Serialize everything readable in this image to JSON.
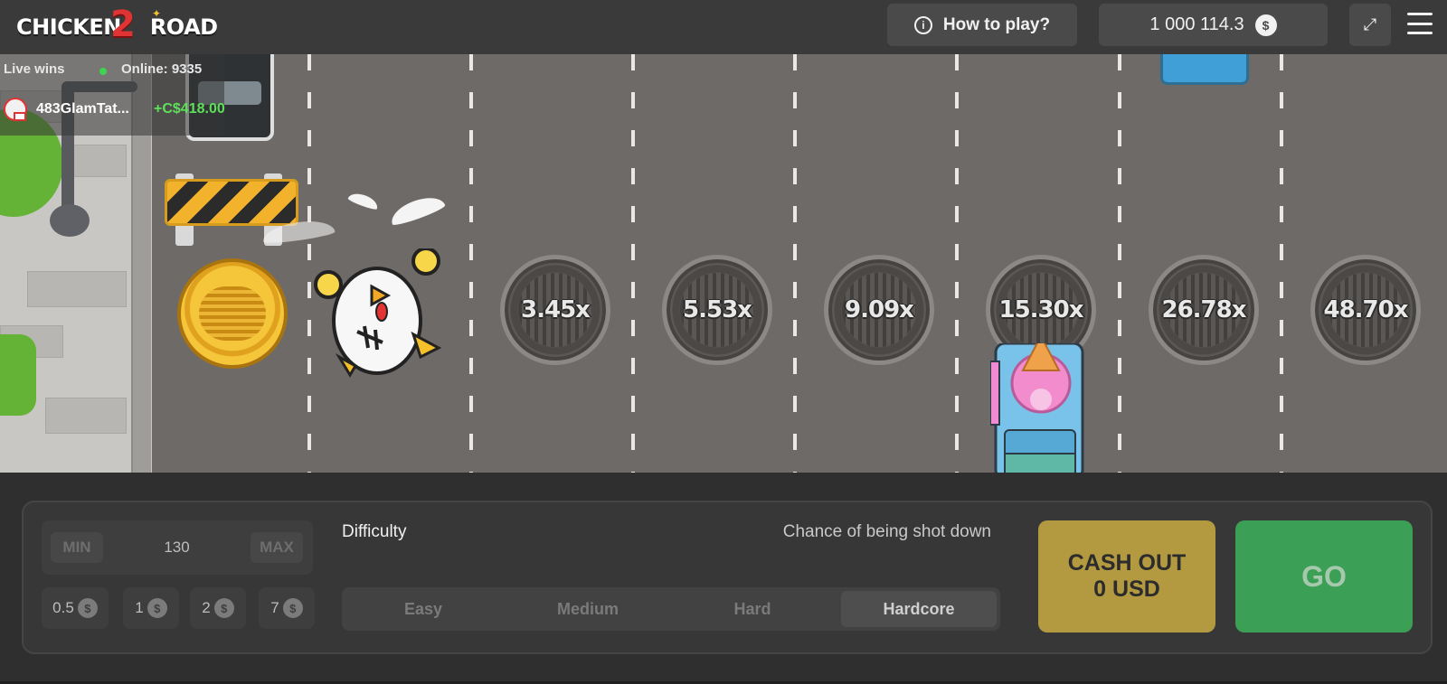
{
  "header": {
    "logo_left": "CHICKEN",
    "logo_mid": "2",
    "logo_right": "ROAD",
    "how_to_play": "How to play?",
    "balance": "1 000 114.3",
    "currency_symbol": "$"
  },
  "live": {
    "label": "Live wins",
    "online": "Online: 9335",
    "latest_user": "483GlamTat...",
    "latest_amount": "+C$418.00"
  },
  "multipliers": [
    "3.45x",
    "5.53x",
    "9.09x",
    "15.30x",
    "26.78x",
    "48.70x"
  ],
  "controls": {
    "min_label": "MIN",
    "max_label": "MAX",
    "bet_amount": "130",
    "chips": [
      "0.5",
      "1",
      "2",
      "7"
    ],
    "chip_symbol": "$",
    "difficulty_label": "Difficulty",
    "chance_label": "Chance of being shot down",
    "difficulty_options": [
      "Easy",
      "Medium",
      "Hard",
      "Hardcore"
    ],
    "selected_difficulty": "Hardcore",
    "cashout_line1": "CASH OUT",
    "cashout_line2": "0 USD",
    "go_label": "GO"
  },
  "icons": {
    "info": "info-icon",
    "fullscreen": "fullscreen-icon",
    "menu": "hamburger-menu-icon"
  },
  "colors": {
    "go": "#3b9f55",
    "cashout": "#b3993f",
    "win_amount": "#5fe05a",
    "logo_two": "#e03434"
  }
}
